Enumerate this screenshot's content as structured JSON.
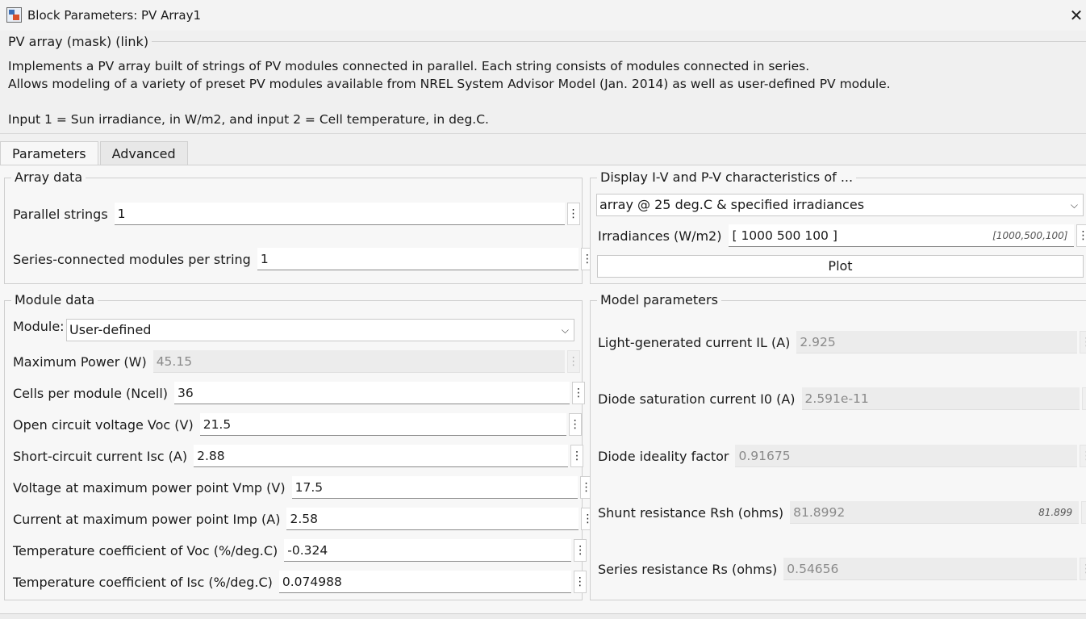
{
  "window": {
    "title": "Block Parameters: PV Array1",
    "icon": "block-parameters-icon",
    "close_glyph": "✕"
  },
  "description": {
    "mask_title": "PV array (mask) (link)",
    "lines": [
      "Implements a PV array built of strings of PV modules connected in parallel. Each string consists of modules connected in series.",
      "Allows modeling of a variety of preset PV modules available from NREL System Advisor Model (Jan. 2014) as well as user-defined PV module.",
      "Input 1 = Sun irradiance, in W/m2, and input 2 = Cell temperature, in deg.C."
    ]
  },
  "tabs": [
    {
      "label": "Parameters",
      "active": true
    },
    {
      "label": "Advanced",
      "active": false
    }
  ],
  "array_data": {
    "title": "Array data",
    "parallel_strings": {
      "label": "Parallel strings",
      "value": "1"
    },
    "series_modules": {
      "label": "Series-connected modules per string",
      "value": "1"
    }
  },
  "module_data": {
    "title": "Module data",
    "module": {
      "label": "Module:",
      "value": "User-defined"
    },
    "max_power": {
      "label": "Maximum Power (W)",
      "value": "45.15"
    },
    "cells": {
      "label": "Cells per module (Ncell)",
      "value": "36"
    },
    "voc": {
      "label": "Open circuit voltage  Voc (V)",
      "value": "21.5"
    },
    "isc": {
      "label": "Short-circuit current Isc (A)",
      "value": "2.88"
    },
    "vmp": {
      "label": "Voltage at maximum power point Vmp (V)",
      "value": "17.5"
    },
    "imp": {
      "label": "Current at maximum power point Imp (A)",
      "value": "2.58"
    },
    "tc_voc": {
      "label": "Temperature coefficient of Voc (%/deg.C)",
      "value": "-0.324"
    },
    "tc_isc": {
      "label": "Temperature coefficient of Isc (%/deg.C)",
      "value": "0.074988"
    }
  },
  "display": {
    "title": "Display  I-V and P-V characteristics of ...",
    "mode": "array @ 25 deg.C & specified irradiances",
    "irradiances": {
      "label": "Irradiances (W/m2)",
      "value": "[ 1000  500  100 ]",
      "evaluated": "[1000,500,100]"
    },
    "plot_label": "Plot"
  },
  "model_params": {
    "title": "Model parameters",
    "il": {
      "label": "Light-generated current IL (A)",
      "value": "2.925"
    },
    "i0": {
      "label": "Diode saturation current I0 (A)",
      "value": "2.591e-11"
    },
    "ideality": {
      "label": "Diode ideality factor",
      "value": "0.91675"
    },
    "rsh": {
      "label": "Shunt resistance Rsh (ohms)",
      "value": "81.8992",
      "evaluated": "81.899"
    },
    "rs": {
      "label": "Series resistance Rs (ohms)",
      "value": "0.54656"
    }
  },
  "glyphs": {
    "kebab": "⋮",
    "chevron": "⌵"
  }
}
